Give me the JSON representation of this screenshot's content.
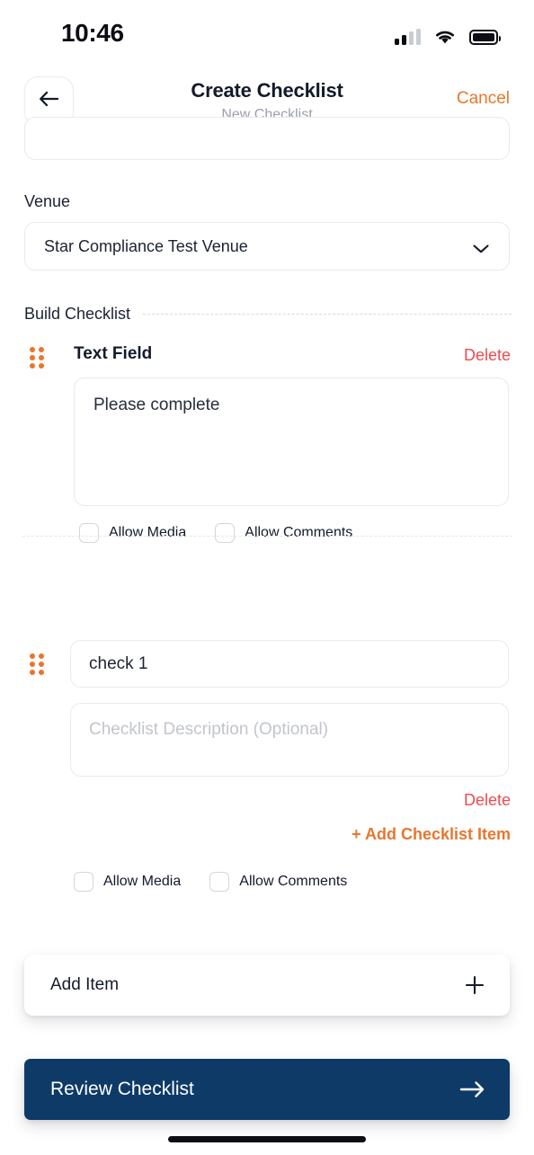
{
  "status_bar": {
    "time": "10:46",
    "signal_icon": "cellular-signal-icon",
    "wifi_icon": "wifi-icon",
    "battery_icon": "battery-icon"
  },
  "header": {
    "back_icon": "arrow-left-icon",
    "title": "Create Checklist",
    "subtitle": "New Checklist",
    "cancel_label": "Cancel"
  },
  "form": {
    "venue_label": "Venue",
    "venue_value": "Star Compliance Test Venue",
    "venue_chevron_icon": "chevron-down-icon",
    "build_label": "Build Checklist"
  },
  "blocks": [
    {
      "drag_icon": "drag-handle-icon",
      "title": "Text Field",
      "delete_label": "Delete",
      "value": "Please complete",
      "allow_media_label": "Allow Media",
      "allow_comments_label": "Allow Comments",
      "allow_media_checked": false,
      "allow_comments_checked": false
    },
    {
      "drag_icon": "drag-handle-icon",
      "value": "check 1",
      "description_placeholder": "Checklist Description (Optional)",
      "description_value": "",
      "delete_label": "Delete",
      "add_checklist_item_label": "+ Add Checklist Item",
      "allow_media_label": "Allow Media",
      "allow_comments_label": "Allow Comments",
      "allow_media_checked": false,
      "allow_comments_checked": false
    }
  ],
  "footer": {
    "add_item_label": "Add Item",
    "add_item_icon": "plus-icon",
    "review_label": "Review Checklist",
    "review_icon": "arrow-right-icon"
  },
  "colors": {
    "accent_orange": "#e8762c",
    "danger_red": "#ee4b4f",
    "primary_navy": "#0e3a68",
    "text_dark": "#131a2a",
    "muted": "#9ba0ab"
  }
}
